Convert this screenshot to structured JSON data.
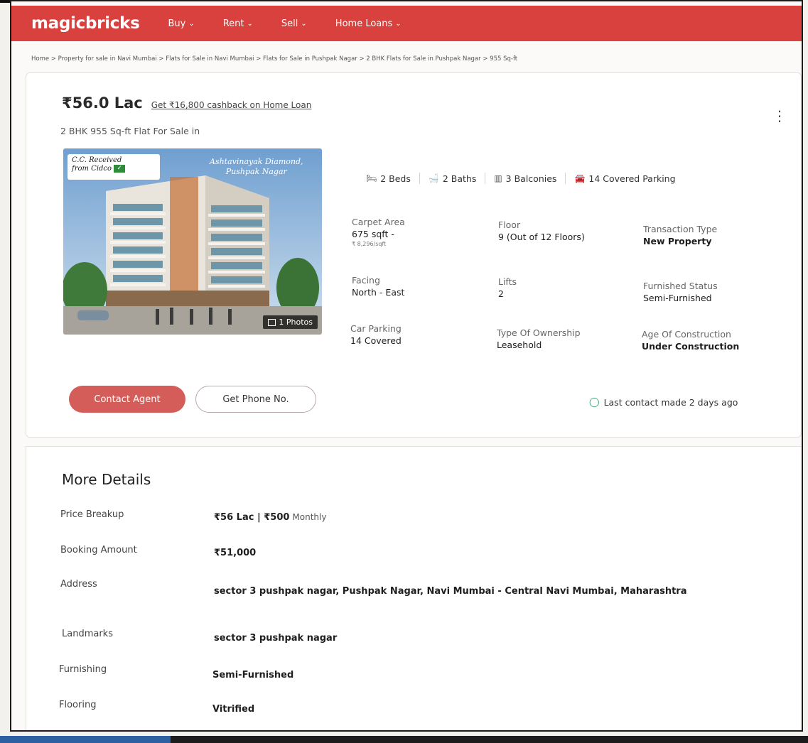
{
  "nav": {
    "logo": "magicbricks",
    "items": [
      "Buy",
      "Rent",
      "Sell",
      "Home Loans"
    ]
  },
  "breadcrumb": "Home > Property for sale in Navi Mumbai > Flats for Sale in Navi Mumbai > Flats for Sale in Pushpak Nagar > 2 BHK Flats for Sale in Pushpak Nagar > 955 Sq-ft",
  "listing": {
    "price": "₹56.0 Lac",
    "cashback": "Get ₹16,800 cashback on Home Loan",
    "subtitle": "2 BHK 955 Sq-ft Flat For Sale in",
    "photo_badge_line1": "C.C. Received",
    "photo_badge_line2": "from Cidco",
    "photo_project_line1": "Ashtavinayak Diamond,",
    "photo_project_line2": "Pushpak Nagar",
    "photos_count": "1 Photos",
    "chips": [
      "2 Beds",
      "2 Baths",
      "3 Balconies",
      "14 Covered Parking"
    ],
    "specs": {
      "carpet_area_label": "Carpet Area",
      "carpet_area_value": "675 sqft -",
      "carpet_area_rate": "₹ 8,296/sqft",
      "floor_label": "Floor",
      "floor_value": "9 (Out of 12 Floors)",
      "transaction_label": "Transaction Type",
      "transaction_value": "New Property",
      "facing_label": "Facing",
      "facing_value": "North - East",
      "lifts_label": "Lifts",
      "lifts_value": "2",
      "furnished_label": "Furnished Status",
      "furnished_value": "Semi-Furnished",
      "car_parking_label": "Car Parking",
      "car_parking_value": "14 Covered",
      "ownership_label": "Type Of Ownership",
      "ownership_value": "Leasehold",
      "age_label": "Age Of Construction",
      "age_value": "Under Construction"
    },
    "contact_button": "Contact Agent",
    "phone_button": "Get Phone No.",
    "last_contact": "Last contact made 2 days ago"
  },
  "details": {
    "title": "More Details",
    "rows": [
      {
        "label": "Price Breakup",
        "value": "₹56 Lac | ₹500",
        "extra": "Monthly"
      },
      {
        "label": "Booking Amount",
        "value": "₹51,000"
      },
      {
        "label": "Address",
        "value": "sector 3 pushpak nagar, Pushpak Nagar, Navi Mumbai - Central Navi Mumbai, Maharashtra"
      },
      {
        "label": "Landmarks",
        "value": "sector 3 pushpak nagar"
      },
      {
        "label": "Furnishing",
        "value": "Semi-Furnished"
      },
      {
        "label": "Flooring",
        "value": "Vitrified"
      }
    ]
  }
}
